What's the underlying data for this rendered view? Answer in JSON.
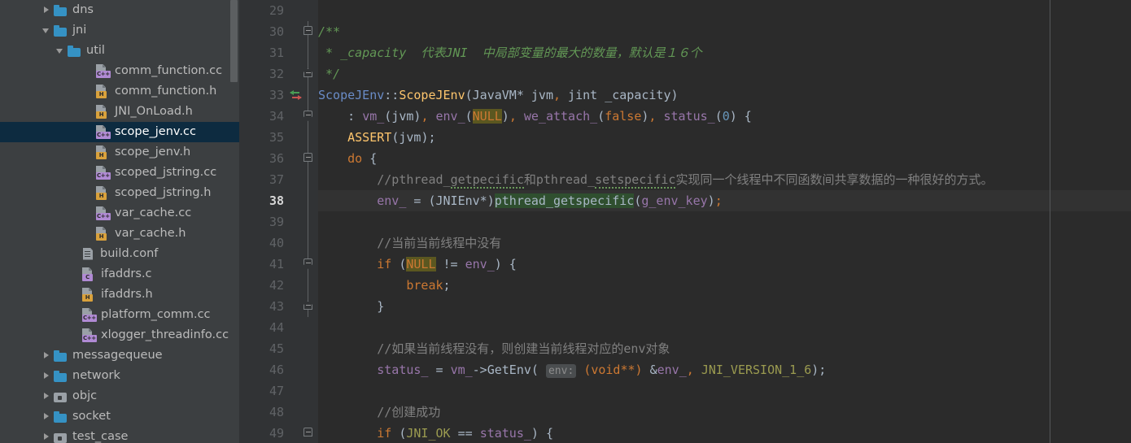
{
  "sidebar": {
    "background": "#3c3f41",
    "selection_color": "#0d2b40",
    "items": [
      {
        "label": "dns",
        "type": "folder",
        "arrow": "collapsed",
        "depth": 3,
        "selected": false
      },
      {
        "label": "jni",
        "type": "folder",
        "arrow": "expanded",
        "depth": 3,
        "selected": false
      },
      {
        "label": "util",
        "type": "folder",
        "arrow": "expanded",
        "depth": 4,
        "selected": false
      },
      {
        "label": "comm_function.cc",
        "type": "file-cpp",
        "arrow": "none",
        "depth": 6,
        "selected": false
      },
      {
        "label": "comm_function.h",
        "type": "file-h",
        "arrow": "none",
        "depth": 6,
        "selected": false
      },
      {
        "label": "JNI_OnLoad.h",
        "type": "file-h",
        "arrow": "none",
        "depth": 6,
        "selected": false
      },
      {
        "label": "scope_jenv.cc",
        "type": "file-cpp",
        "arrow": "none",
        "depth": 6,
        "selected": true
      },
      {
        "label": "scope_jenv.h",
        "type": "file-h",
        "arrow": "none",
        "depth": 6,
        "selected": false
      },
      {
        "label": "scoped_jstring.cc",
        "type": "file-cpp",
        "arrow": "none",
        "depth": 6,
        "selected": false
      },
      {
        "label": "scoped_jstring.h",
        "type": "file-h",
        "arrow": "none",
        "depth": 6,
        "selected": false
      },
      {
        "label": "var_cache.cc",
        "type": "file-cpp",
        "arrow": "none",
        "depth": 6,
        "selected": false
      },
      {
        "label": "var_cache.h",
        "type": "file-h",
        "arrow": "none",
        "depth": 6,
        "selected": false
      },
      {
        "label": "build.conf",
        "type": "file-conf",
        "arrow": "none",
        "depth": 5,
        "selected": false
      },
      {
        "label": "ifaddrs.c",
        "type": "file-c",
        "arrow": "none",
        "depth": 5,
        "selected": false
      },
      {
        "label": "ifaddrs.h",
        "type": "file-h",
        "arrow": "none",
        "depth": 5,
        "selected": false
      },
      {
        "label": "platform_comm.cc",
        "type": "file-cpp",
        "arrow": "none",
        "depth": 5,
        "selected": false
      },
      {
        "label": "xlogger_threadinfo.cc",
        "type": "file-cpp",
        "arrow": "none",
        "depth": 5,
        "selected": false
      },
      {
        "label": "messagequeue",
        "type": "folder",
        "arrow": "collapsed",
        "depth": 3,
        "selected": false
      },
      {
        "label": "network",
        "type": "folder",
        "arrow": "collapsed",
        "depth": 3,
        "selected": false
      },
      {
        "label": "objc",
        "type": "folder-grey",
        "arrow": "collapsed",
        "depth": 3,
        "selected": false
      },
      {
        "label": "socket",
        "type": "folder",
        "arrow": "collapsed",
        "depth": 3,
        "selected": false
      },
      {
        "label": "test_case",
        "type": "folder-grey",
        "arrow": "collapsed",
        "depth": 3,
        "selected": false
      }
    ],
    "badges": {
      "cpp": "C++",
      "h": "H",
      "c": "C"
    }
  },
  "editor": {
    "background": "#2b2b2b",
    "gutter_background": "#313335",
    "current_line_background": "#323232",
    "current_line_number": 38,
    "first_line_number": 29,
    "right_margin_column_x": 987,
    "lines": [
      {
        "n": 29,
        "text": ""
      },
      {
        "n": 30,
        "text": "/**"
      },
      {
        "n": 31,
        "text": " * _capacity  代表JNI  中局部变量的最大的数量，默认是１６个"
      },
      {
        "n": 32,
        "text": " */"
      },
      {
        "n": 33,
        "text": "ScopeJEnv::ScopeJEnv(JavaVM* jvm, jint _capacity)"
      },
      {
        "n": 34,
        "text": "    : vm_(jvm), env_(NULL), we_attach_(false), status_(0) {"
      },
      {
        "n": 35,
        "text": "    ASSERT(jvm);"
      },
      {
        "n": 36,
        "text": "    do {"
      },
      {
        "n": 37,
        "text": "        //pthread_getpecific和pthread_setspecific实现同一个线程中不同函数间共享数据的一种很好的方式。"
      },
      {
        "n": 38,
        "text": "        env_ = (JNIEnv*)pthread_getspecific(g_env_key);"
      },
      {
        "n": 39,
        "text": ""
      },
      {
        "n": 40,
        "text": "        //当前当前线程中没有"
      },
      {
        "n": 41,
        "text": "        if (NULL != env_) {"
      },
      {
        "n": 42,
        "text": "            break;"
      },
      {
        "n": 43,
        "text": "        }"
      },
      {
        "n": 44,
        "text": ""
      },
      {
        "n": 45,
        "text": "        //如果当前线程没有，则创建当前线程对应的env对象"
      },
      {
        "n": 46,
        "text": "        status_ = vm_->GetEnv( env: (void**) &env_, JNI_VERSION_1_6);"
      },
      {
        "n": 47,
        "text": ""
      },
      {
        "n": 48,
        "text": "        //创建成功"
      },
      {
        "n": 49,
        "text": "        if (JNI_OK == status_) {"
      }
    ],
    "tokens": {
      "doc_open": "/**",
      "doc_body_star": " * ",
      "doc_param": "_capacity",
      "doc_cn": "代表JNI  中局部变量的最大的数量，默认是１６个",
      "doc_close": " */",
      "class_name": "ScopeJEnv",
      "scope_op": "::",
      "ctor_name": "ScopeJEnv",
      "param_type_1": "JavaVM*",
      "param_name_1": "jvm",
      "param_type_2": "jint",
      "param_name_2": "_capacity",
      "init_colon": ": ",
      "field_vm": "vm_",
      "field_env": "env_",
      "field_we_attach": "we_attach_",
      "field_status": "status_",
      "null": "NULL",
      "false": "false",
      "zero": "0",
      "assert": "ASSERT",
      "do": "do",
      "comment_37": "//pthread_getpecific和pthread_setspecific实现同一个线程中不同函数间共享数据的一种很好的方式。",
      "typo_1": "getpecific",
      "typo_2": "setspecific",
      "cast_jnienv": "(JNIEnv*)",
      "fn_getspecific": "pthread_getspecific",
      "arg_g_env_key": "g_env_key",
      "comment_40": "//当前当前线程中没有",
      "if": "if",
      "neq": "!=",
      "break": "break",
      "comment_45": "//如果当前线程没有，则创建当前线程对应的env对象",
      "fn_getenv": "GetEnv",
      "hint_env": "env:",
      "cast_voidpp": "(void**)",
      "amp_env": "&env_",
      "jni_version": "JNI_VERSION_1_6",
      "comment_48": "//创建成功",
      "jni_ok": "JNI_OK",
      "eq": "==",
      "arrow_op": "->"
    },
    "gutter_marks": {
      "line_30": "fold-start",
      "line_32": "fold-end",
      "line_33": "override-implement-arrows",
      "line_34": "fold-mid",
      "line_36": "fold-start",
      "line_41": "fold-mid",
      "line_43": "fold-end",
      "line_49": "fold-start"
    }
  }
}
